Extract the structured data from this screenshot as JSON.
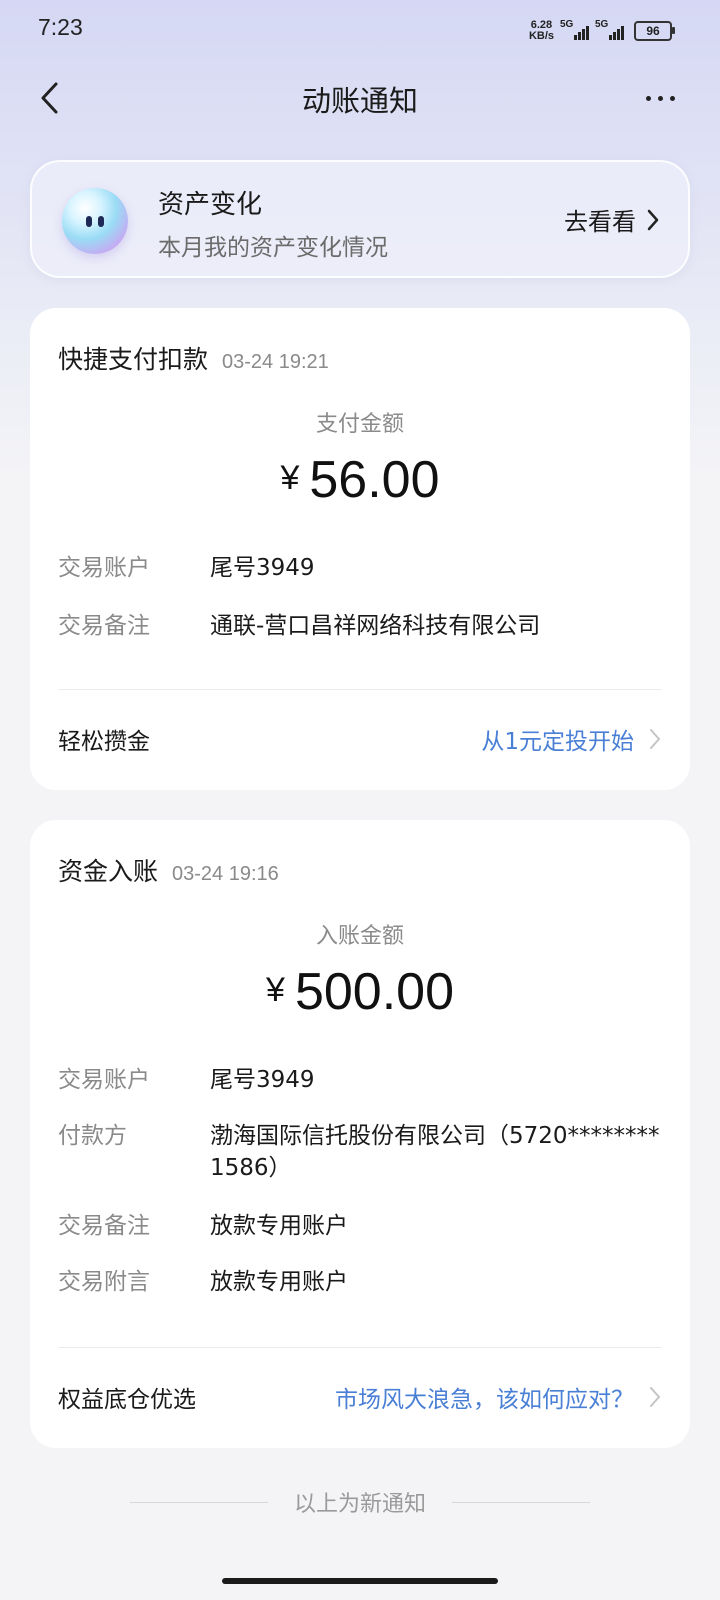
{
  "status_bar": {
    "time": "7:23",
    "net_speed_value": "6.28",
    "net_speed_unit": "KB/s",
    "signal1_label": "5G",
    "signal2_label": "5G",
    "battery": "96"
  },
  "header": {
    "title": "动账通知",
    "back_icon": "chevron-left-icon",
    "more_icon": "more-dots-icon"
  },
  "banner": {
    "title": "资产变化",
    "subtitle": "本月我的资产变化情况",
    "action_label": "去看看"
  },
  "cards": [
    {
      "type": "快捷支付扣款",
      "time": "03-24 19:21",
      "amount_label": "支付金额",
      "currency": "¥",
      "amount": "56.00",
      "rows": [
        {
          "key": "交易账户",
          "value": "尾号3949"
        },
        {
          "key": "交易备注",
          "value": "通联-营口昌祥网络科技有限公司"
        }
      ],
      "promo_label": "轻松攒金",
      "promo_link": "从1元定投开始"
    },
    {
      "type": "资金入账",
      "time": "03-24 19:16",
      "amount_label": "入账金额",
      "currency": "¥",
      "amount": "500.00",
      "rows": [
        {
          "key": "交易账户",
          "value": "尾号3949"
        },
        {
          "key": "付款方",
          "value": "渤海国际信托股份有限公司（5720********1586）"
        },
        {
          "key": "交易备注",
          "value": "放款专用账户"
        },
        {
          "key": "交易附言",
          "value": "放款专用账户"
        }
      ],
      "promo_label": "权益底仓优选",
      "promo_link": "市场风大浪急，该如何应对？"
    }
  ],
  "footer": {
    "note": "以上为新通知"
  },
  "colors": {
    "link": "#4a7fd6",
    "secondary_text": "#8a8a8a",
    "header_gradient": "#d5d8f4"
  }
}
